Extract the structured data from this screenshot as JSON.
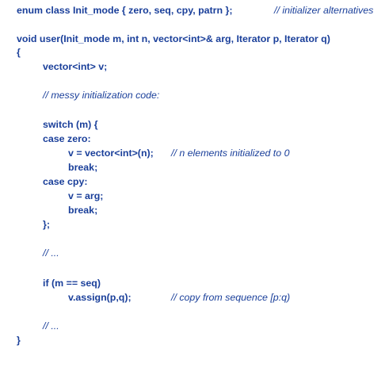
{
  "colors": {
    "code_text": "#1a3f9a",
    "background": "#ffffff"
  },
  "lines": [
    {
      "code": "enum class Init_mode { zero, seq, cpy, patrn };",
      "comment": "// initializer alternatives"
    },
    {
      "code": "void user(Init_mode m, int n, vector<int>& arg, Iterator p, Iterator q)",
      "comment": ""
    },
    {
      "code": "{",
      "comment": ""
    },
    {
      "code": "vector<int> v;",
      "comment": ""
    },
    {
      "code": "",
      "comment": "// messy initialization code:"
    },
    {
      "code": "switch (m) {",
      "comment": ""
    },
    {
      "code": "case zero:",
      "comment": ""
    },
    {
      "code": "v = vector<int>(n);",
      "comment": "// n elements initialized to 0"
    },
    {
      "code": "break;",
      "comment": ""
    },
    {
      "code": "case cpy:",
      "comment": ""
    },
    {
      "code": "v = arg;",
      "comment": ""
    },
    {
      "code": "break;",
      "comment": ""
    },
    {
      "code": "};",
      "comment": ""
    },
    {
      "code": "",
      "comment": "// ..."
    },
    {
      "code": "if (m == seq)",
      "comment": ""
    },
    {
      "code": "v.assign(p,q);",
      "comment": "// copy from sequence [p:q)"
    },
    {
      "code": "",
      "comment": "// ..."
    },
    {
      "code": "}",
      "comment": ""
    }
  ]
}
